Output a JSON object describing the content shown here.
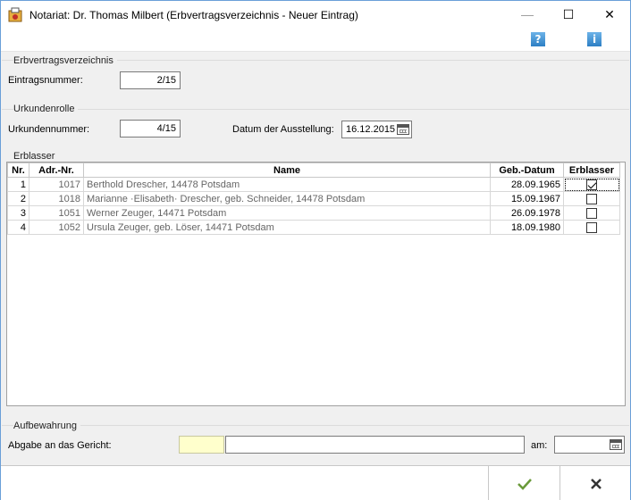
{
  "window": {
    "title": "Notariat: Dr. Thomas Milbert (Erbvertragsverzeichnis - Neuer Eintrag)",
    "min_glyph": "—",
    "max_glyph": "☐",
    "close_glyph": "✕"
  },
  "toolbar": {
    "help_glyph": "?",
    "info_glyph": "i"
  },
  "erbvertragsverzeichnis": {
    "section_label": "Erbvertragsverzeichnis",
    "eintragsnummer_label": "Eintragsnummer:",
    "eintragsnummer_value": "2/15"
  },
  "urkundenrolle": {
    "section_label": "Urkundenrolle",
    "urkundennummer_label": "Urkundennummer:",
    "urkundennummer_value": "4/15",
    "datum_label": "Datum der Ausstellung:",
    "datum_value": "16.12.2015"
  },
  "erblasser": {
    "section_label": "Erblasser",
    "columns": [
      "Nr.",
      "Adr.-Nr.",
      "Name",
      "Geb.-Datum",
      "Erblasser"
    ],
    "rows": [
      {
        "nr": "1",
        "adr": "1017",
        "name": "Berthold Drescher, 14478 Potsdam",
        "geb": "28.09.1965",
        "checked": true
      },
      {
        "nr": "2",
        "adr": "1018",
        "name": "Marianne ·Elisabeth· Drescher, geb. Schneider, 14478 Potsdam",
        "geb": "15.09.1967",
        "checked": false
      },
      {
        "nr": "3",
        "adr": "1051",
        "name": "Werner Zeuger, 14471 Potsdam",
        "geb": "26.09.1978",
        "checked": false
      },
      {
        "nr": "4",
        "adr": "1052",
        "name": "Ursula Zeuger, geb. Löser, 14471 Potsdam",
        "geb": "18.09.1980",
        "checked": false
      }
    ]
  },
  "aufbewahrung": {
    "section_label": "Aufbewahrung",
    "abgabe_label": "Abgabe an das Gericht:",
    "gericht_code_value": "",
    "gericht_name_value": "",
    "am_label": "am:",
    "am_value": ""
  },
  "colors": {
    "accent": "#2d7fc4",
    "ok_check": "#6a9a3a",
    "code_field_bg": "#ffffcc"
  },
  "actions": {
    "ok_icon": "check-icon",
    "cancel_icon": "cross-icon"
  }
}
